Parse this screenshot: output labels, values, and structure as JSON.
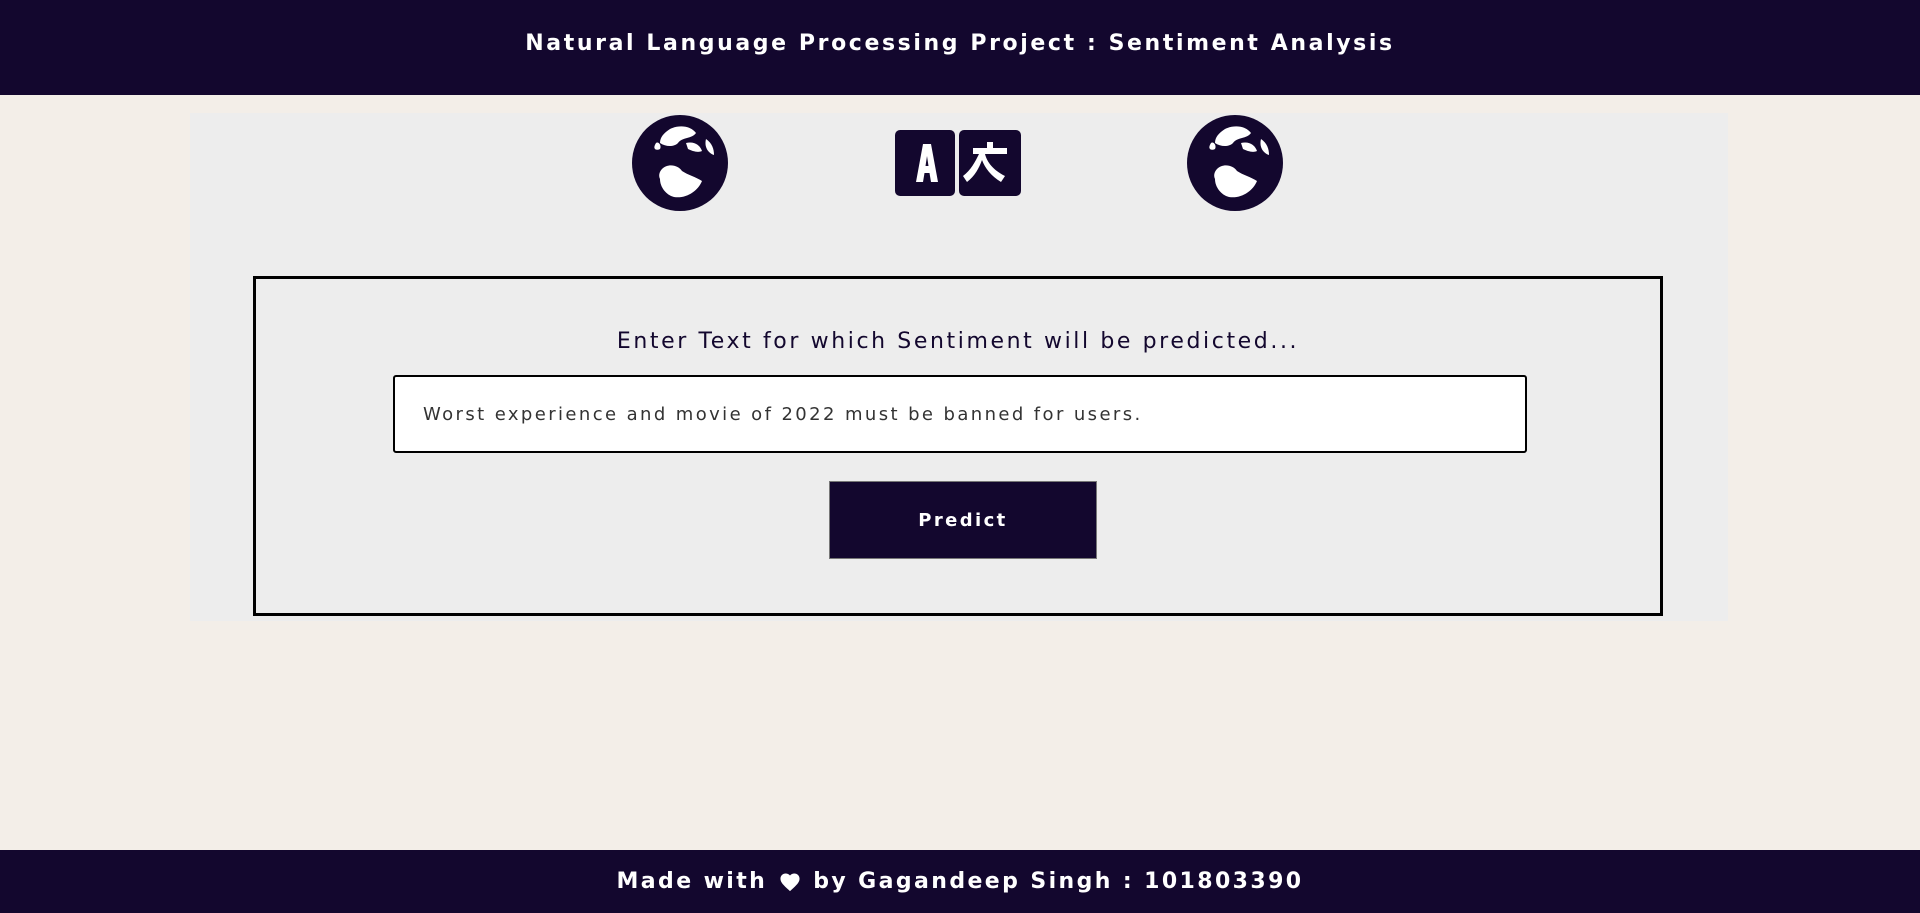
{
  "header": {
    "title": "Natural Language Processing Project : Sentiment Analysis"
  },
  "icons": {
    "left": "globe-europe-icon",
    "center": "translate-icon",
    "right": "globe-europe-icon"
  },
  "form": {
    "prompt": "Enter Text for which Sentiment will be predicted...",
    "input_value": "Worst experience and movie of 2022 must be banned for users.",
    "button_label": "Predict"
  },
  "footer": {
    "made_with": "Made with",
    "heart_icon": "heart-icon",
    "by_text": "by Gagandeep Singh : 101803390"
  },
  "colors": {
    "primary": "#13072e",
    "page_background": "#f3eee8",
    "panel_background": "#ededed"
  }
}
